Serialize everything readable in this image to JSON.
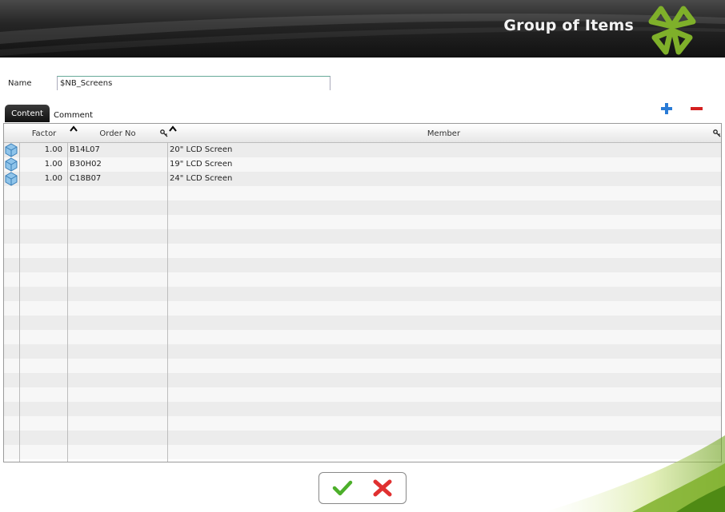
{
  "header": {
    "title": "Group of Items",
    "logo_icon": "clover-logo-icon",
    "accent_color": "#7fb02a"
  },
  "form": {
    "name_label": "Name",
    "name_value": "$NB_Screens"
  },
  "tabs": [
    {
      "label": "Content",
      "active": true
    },
    {
      "label": "Comment",
      "active": false
    }
  ],
  "toolbar": {
    "add_icon": "plus-icon",
    "add_color": "#2a7bd6",
    "remove_icon": "minus-icon",
    "remove_color": "#d42020"
  },
  "grid": {
    "columns": [
      "Factor",
      "Order No",
      "Member"
    ],
    "rows": [
      {
        "icon": "cube-icon",
        "factor": "1.00",
        "order_no": "B14L07",
        "member": "20\" LCD Screen"
      },
      {
        "icon": "cube-icon",
        "factor": "1.00",
        "order_no": "B30H02",
        "member": "19\" LCD Screen"
      },
      {
        "icon": "cube-icon",
        "factor": "1.00",
        "order_no": "C18B07",
        "member": "24\" LCD Screen"
      }
    ]
  },
  "actions": {
    "ok_icon": "checkmark-icon",
    "ok_color": "#4caf2a",
    "cancel_icon": "cross-icon",
    "cancel_color": "#e03030"
  }
}
